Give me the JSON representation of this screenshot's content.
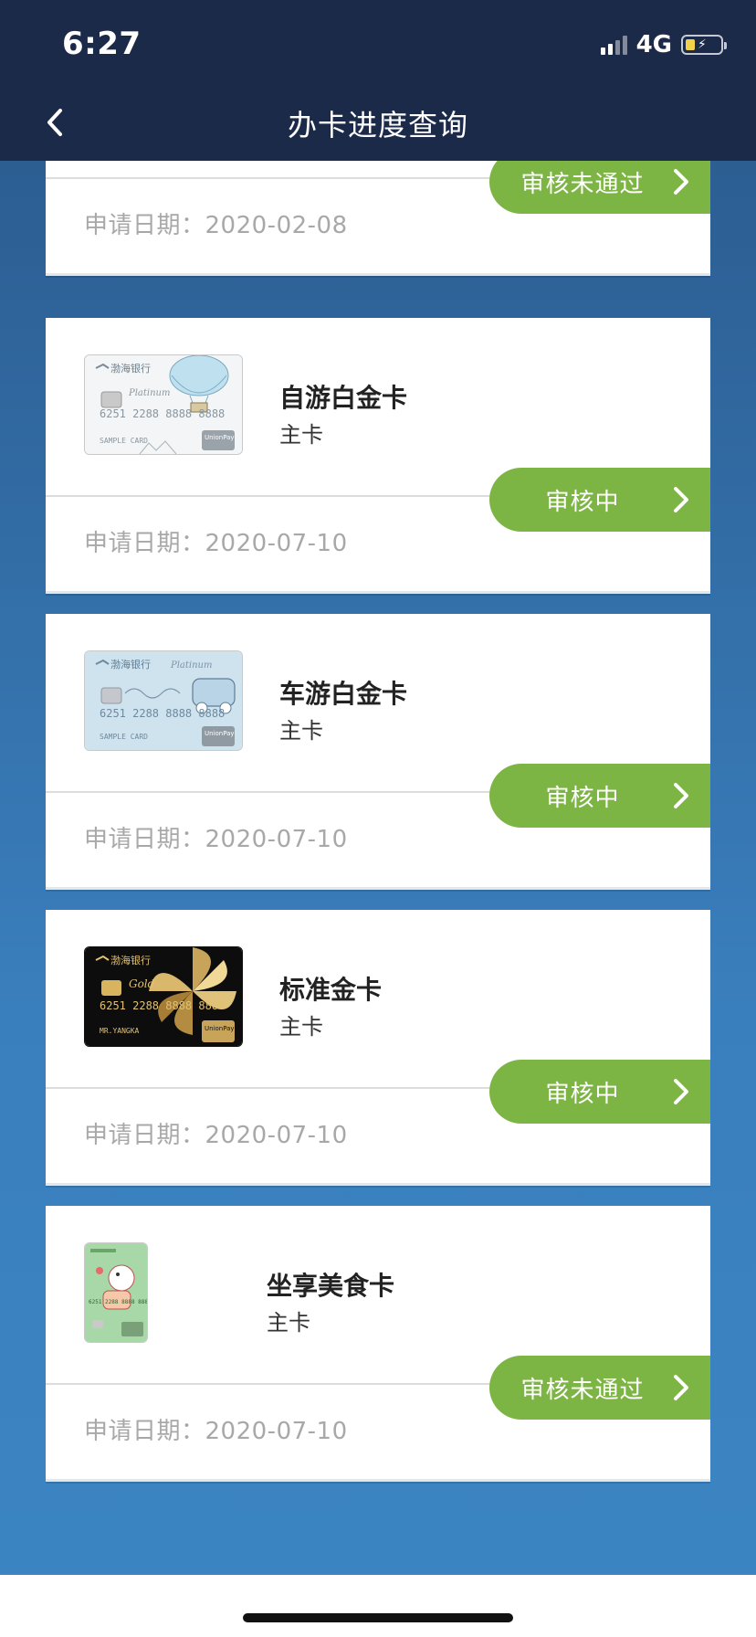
{
  "status_bar": {
    "time": "6:27",
    "network": "4G",
    "battery_color": "#f2d14b"
  },
  "nav": {
    "title": "办卡进度查询",
    "back_icon": "chevron-left-icon"
  },
  "colors": {
    "header_bg": "#1c2a4a",
    "content_bg": "#3a7fbd",
    "status_btn": "#7db544"
  },
  "applications": [
    {
      "status": "审核未通过",
      "date_label": "申请日期：",
      "date": "2020-02-08"
    },
    {
      "card_name": "自游白金卡",
      "card_type": "主卡",
      "status": "审核中",
      "date_label": "申请日期：",
      "date": "2020-07-10"
    },
    {
      "card_name": "车游白金卡",
      "card_type": "主卡",
      "status": "审核中",
      "date_label": "申请日期：",
      "date": "2020-07-10"
    },
    {
      "card_name": "标准金卡",
      "card_type": "主卡",
      "status": "审核中",
      "date_label": "申请日期：",
      "date": "2020-07-10"
    },
    {
      "card_name": "坐享美食卡",
      "card_type": "主卡",
      "status": "审核未通过",
      "date_label": "申请日期：",
      "date": "2020-07-10"
    }
  ],
  "card_art": {
    "bank_name": "渤海银行",
    "platinum_script": "Platinum",
    "gold_script": "Gold",
    "card_number": "6251 2288 8888 8888",
    "sample_text": "SAMPLE CARD",
    "holder_name": "MR.YANGKA",
    "unionpay": "UnionPay"
  }
}
